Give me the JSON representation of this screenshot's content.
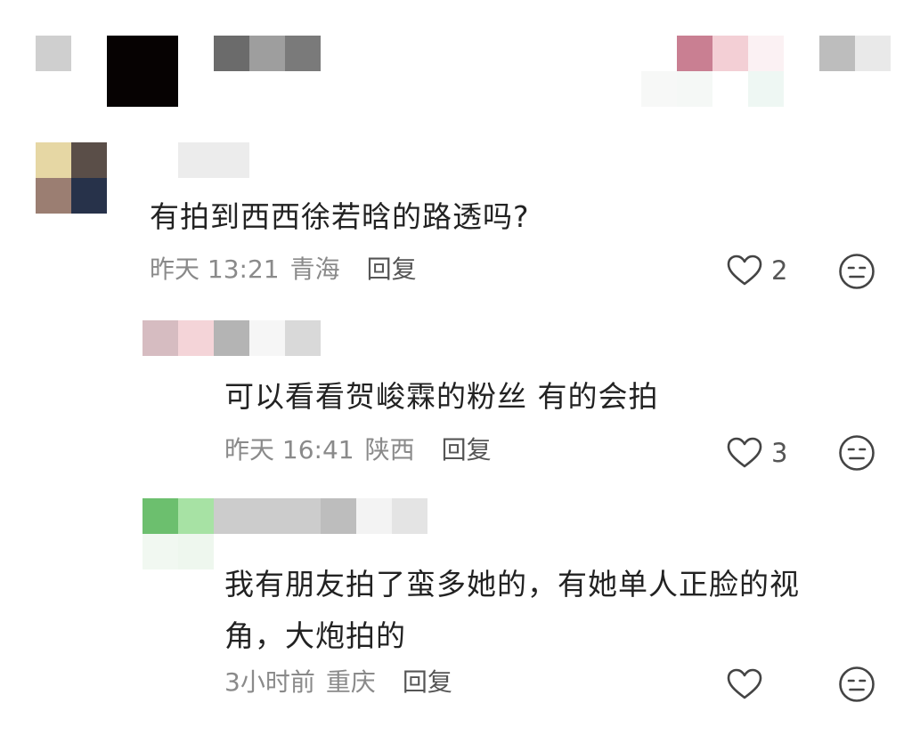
{
  "comments": [
    {
      "text": "有拍到西西徐若晗的路透吗?",
      "time": "昨天 13:21",
      "location": "青海",
      "reply_label": "回复",
      "likes": "2"
    },
    {
      "text": "可以看看贺峻霖的粉丝 有的会拍",
      "time": "昨天 16:41",
      "location": "陕西",
      "reply_label": "回复",
      "likes": "3"
    },
    {
      "text": "我有朋友拍了蛮多她的，有她单人正脸的视\n角，大炮拍的",
      "time": "3小时前",
      "location": "重庆",
      "reply_label": "回复",
      "likes": ""
    }
  ],
  "colors": {
    "text": "#222222",
    "meta": "#8a8a8a",
    "icon": "#444444"
  },
  "icons": {
    "like": "heart-outline-icon",
    "emoji": "expressionless-face-icon"
  }
}
